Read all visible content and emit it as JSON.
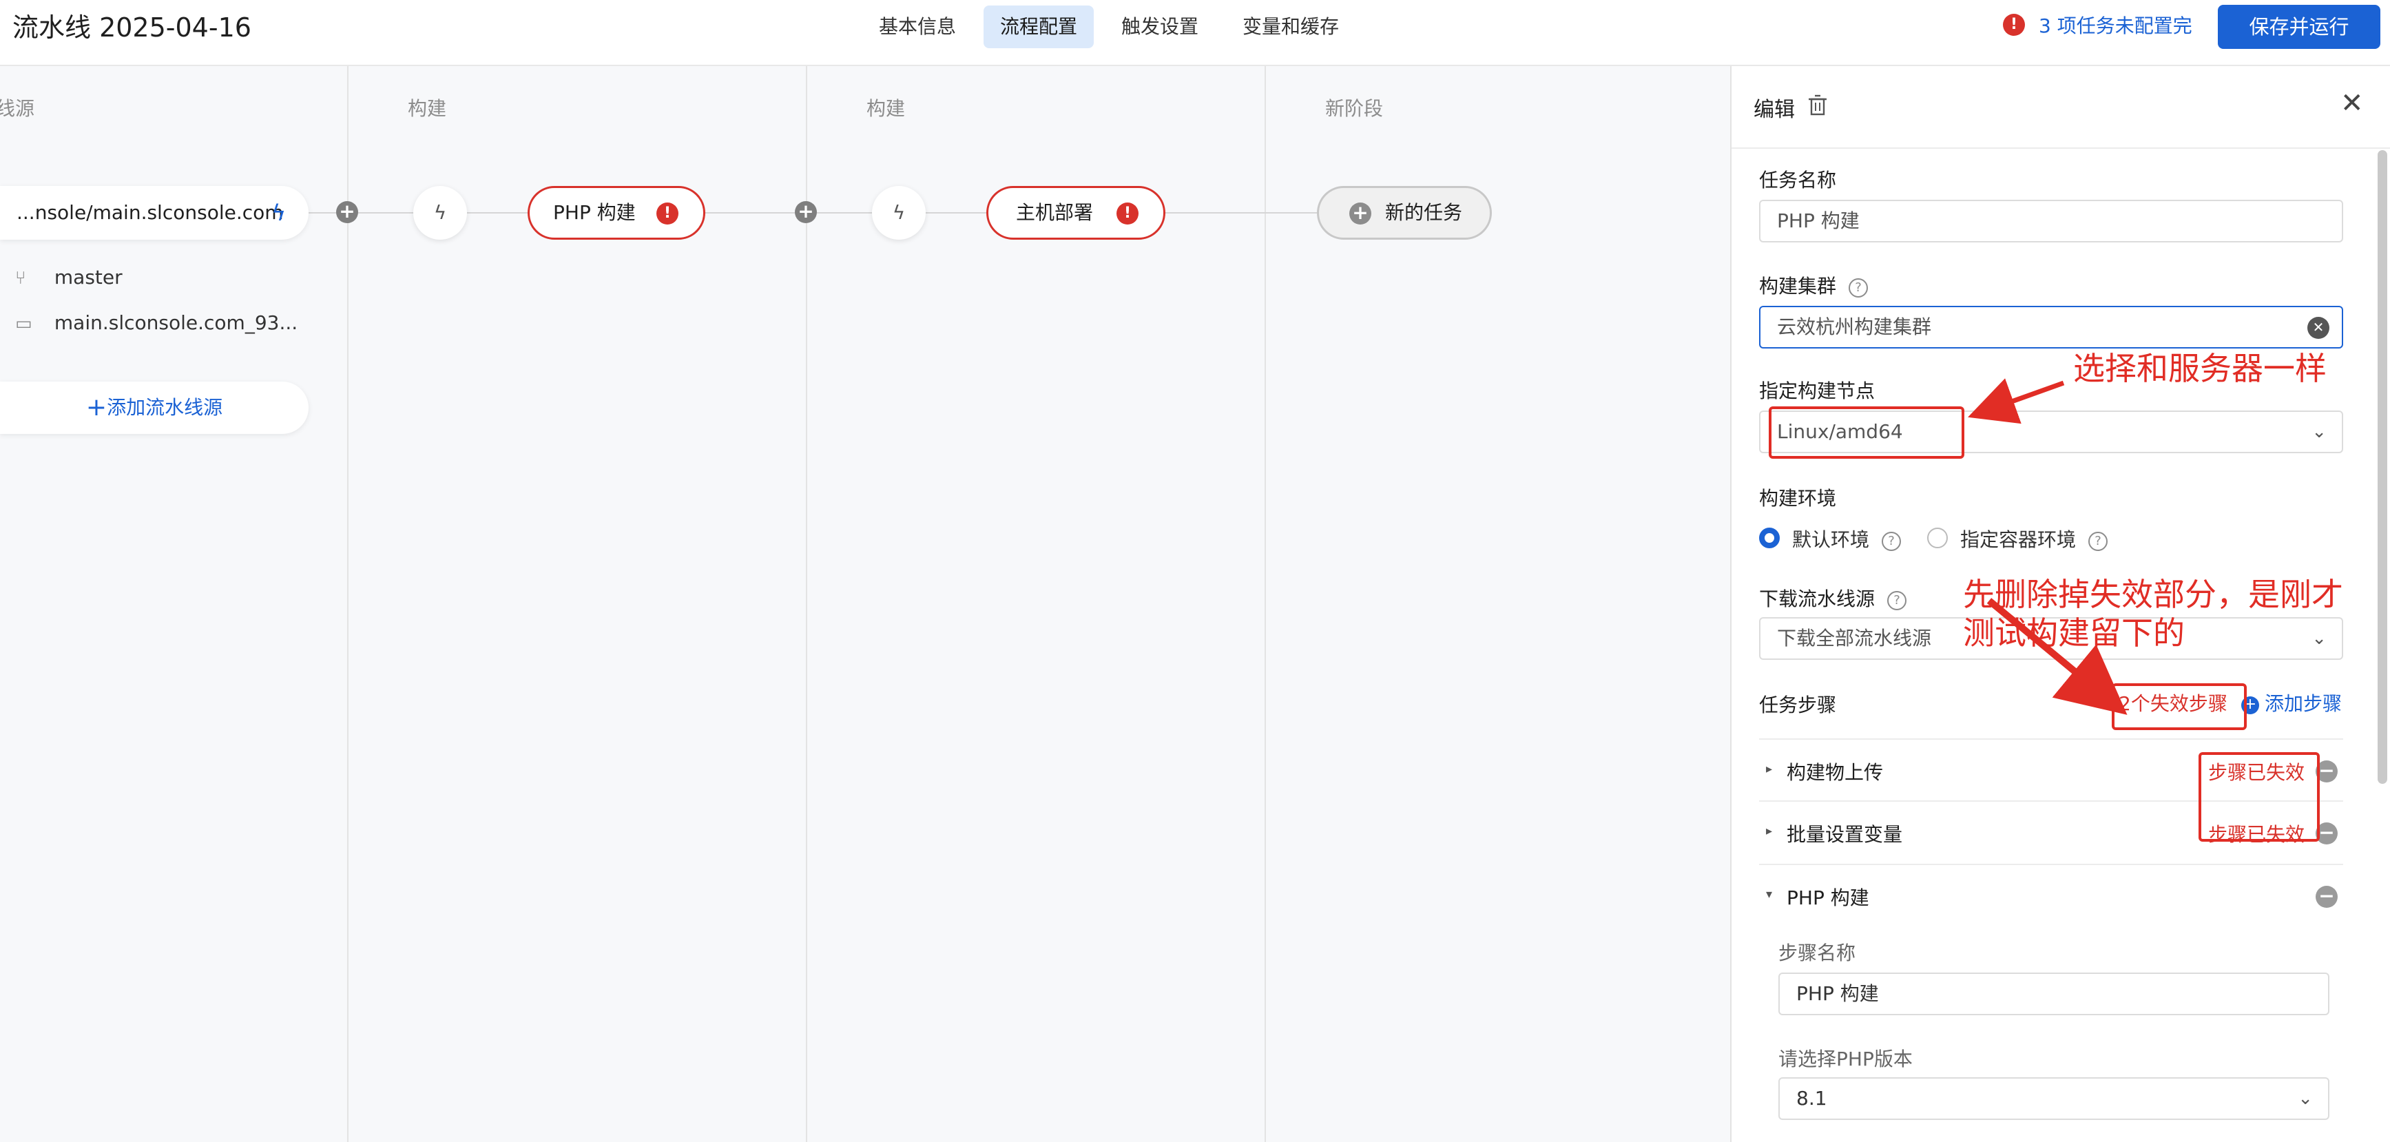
{
  "header": {
    "title": "流水线 2025-04-16",
    "tabs": [
      {
        "label": "基本信息"
      },
      {
        "label": "流程配置"
      },
      {
        "label": "触发设置"
      },
      {
        "label": "变量和缓存"
      }
    ],
    "warning_text": "3 项任务未配置完",
    "save_run_label": "保存并运行"
  },
  "canvas": {
    "stages": [
      {
        "title": "线源"
      },
      {
        "title": "构建"
      },
      {
        "title": "构建"
      },
      {
        "title": "新阶段"
      }
    ],
    "source": {
      "repo": "...nsole/main.slconsole.com",
      "branch": "master",
      "folder": "main.slconsole.com_93...",
      "add_label": "添加流水线源"
    },
    "jobs": [
      {
        "label": "PHP 构建"
      },
      {
        "label": "主机部署"
      }
    ],
    "new_task_label": "新的任务"
  },
  "panel": {
    "edit_label": "编辑",
    "task_name_label": "任务名称",
    "task_name_value": "PHP 构建",
    "cluster_label": "构建集群",
    "cluster_value": "云效杭州构建集群",
    "node_label": "指定构建节点",
    "node_value": "Linux/amd64",
    "env_label": "构建环境",
    "env_default": "默认环境",
    "env_container": "指定容器环境",
    "download_label": "下载流水线源",
    "download_value": "下载全部流水线源",
    "steps_label": "任务步骤",
    "invalid_steps": "2个失效步骤",
    "add_step_label": "添加步骤",
    "steps": [
      {
        "name": "构建物上传",
        "status": "步骤已失效"
      },
      {
        "name": "批量设置变量",
        "status": "步骤已失效"
      },
      {
        "name": "PHP 构建",
        "status": ""
      }
    ],
    "step_name_label": "步骤名称",
    "step_name_value": "PHP 构建",
    "php_version_label": "请选择PHP版本",
    "php_version_value": "8.1"
  },
  "annotations": {
    "note1": "选择和服务器一样",
    "note2_line1": "先删除掉失效部分，是刚才",
    "note2_line2": "测试构建留下的"
  },
  "colors": {
    "accent": "#1b62d4",
    "error": "#d8322b",
    "annotation": "#e12d25"
  }
}
